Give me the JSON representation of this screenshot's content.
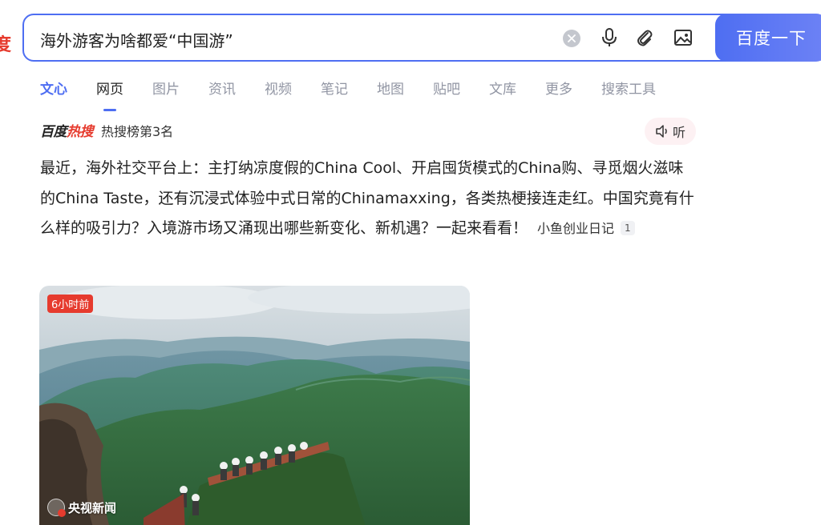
{
  "search": {
    "query": "海外游客为啥都爱“中国游”",
    "submit_label": "百度一下"
  },
  "tabs": [
    {
      "label": "文心"
    },
    {
      "label": "网页"
    },
    {
      "label": "图片"
    },
    {
      "label": "资讯"
    },
    {
      "label": "视频"
    },
    {
      "label": "笔记"
    },
    {
      "label": "地图"
    },
    {
      "label": "贴吧"
    },
    {
      "label": "文库"
    },
    {
      "label": "更多"
    },
    {
      "label": "搜索工具"
    }
  ],
  "hot": {
    "brand_a": "百度",
    "brand_b": "热搜",
    "rank": "热搜榜第3名",
    "listen_label": "听"
  },
  "summary": {
    "text": "最近，海外社交平台上：主打纳凉度假的China Cool、开启囤货模式的China购、寻觅烟火滋味的China Taste，还有沉浸式体验中式日常的Chinamaxxing，各类热梗接连走红。中国究竟有什么样的吸引力？入境游市场又涌现出哪些新变化、新机遇？一起来看看！",
    "source": "小鱼创业日记",
    "citation": "1"
  },
  "image_card": {
    "time_badge": "6小时前",
    "source": "央视新闻"
  },
  "colors": {
    "accent": "#4e6ef2",
    "brand_red": "#e63b2e"
  }
}
